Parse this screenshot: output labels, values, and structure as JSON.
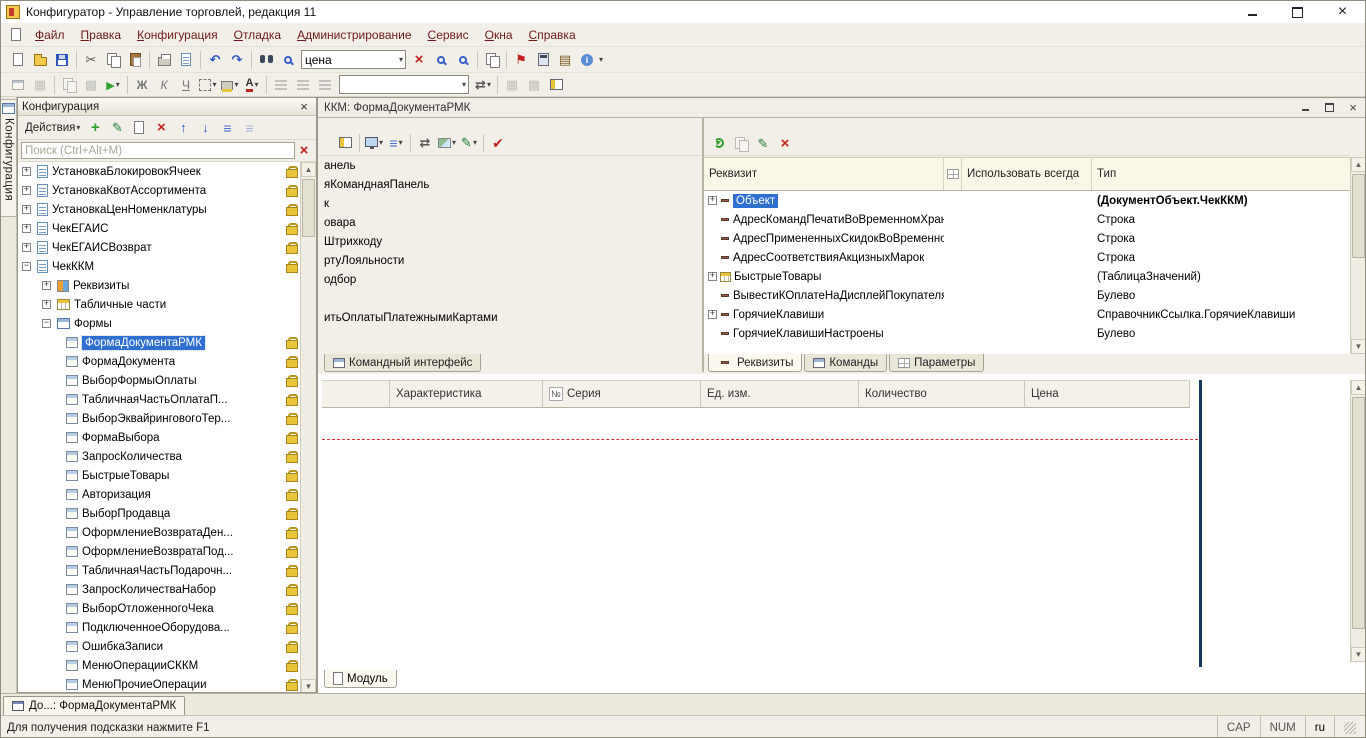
{
  "titlebar": {
    "title": "Конфигуратор - Управление торговлей, редакция 11"
  },
  "menubar": {
    "items": [
      "Файл",
      "Правка",
      "Конфигурация",
      "Отладка",
      "Администрирование",
      "Сервис",
      "Окна",
      "Справка"
    ]
  },
  "toolbar_main": {
    "search_value": "цена"
  },
  "toolbar_format": {
    "bold": "Ж",
    "italic": "К",
    "underline": "Ч"
  },
  "dock": {
    "tab_label": "Конфигурация"
  },
  "config_panel": {
    "title": "Конфигурация",
    "actions_label": "Действия",
    "search_placeholder": "Поиск (Ctrl+Alt+M)",
    "tree": [
      {
        "label": "УстановкаБлокировокЯчеек",
        "locked": true
      },
      {
        "label": "УстановкаКвотАссортимента",
        "locked": true
      },
      {
        "label": "УстановкаЦенНоменклатуры",
        "locked": true
      },
      {
        "label": "ЧекЕГАИС",
        "locked": true
      },
      {
        "label": "ЧекЕГАИСВозврат",
        "locked": true
      },
      {
        "label": "ЧекККМ",
        "locked": true,
        "expanded": true
      },
      {
        "label": "Реквизиты"
      },
      {
        "label": "Табличные части"
      },
      {
        "label": "Формы",
        "expanded": true
      },
      {
        "label": "ФормаДокументаРМК",
        "locked": true,
        "selected": true
      },
      {
        "label": "ФормаДокумента",
        "locked": true
      },
      {
        "label": "ВыборФормыОплаты",
        "locked": true
      },
      {
        "label": "ТабличнаяЧастьОплатаП...",
        "locked": true
      },
      {
        "label": "ВыборЭквайринговогоТер...",
        "locked": true
      },
      {
        "label": "ФормаВыбора",
        "locked": true
      },
      {
        "label": "ЗапросКоличества",
        "locked": true
      },
      {
        "label": "БыстрыеТовары",
        "locked": true
      },
      {
        "label": "Авторизация",
        "locked": true
      },
      {
        "label": "ВыборПродавца",
        "locked": true
      },
      {
        "label": "ОформлениеВозвратаДен...",
        "locked": true
      },
      {
        "label": "ОформлениеВозвратаПод...",
        "locked": true
      },
      {
        "label": "ТабличнаяЧастьПодарочн...",
        "locked": true
      },
      {
        "label": "ЗапросКоличестваНабор",
        "locked": true
      },
      {
        "label": "ВыборОтложенногоЧека",
        "locked": true
      },
      {
        "label": "ПодключенноеОборудова...",
        "locked": true
      },
      {
        "label": "ОшибкаЗаписи",
        "locked": true
      },
      {
        "label": "МенюОперацииСККМ",
        "locked": true
      },
      {
        "label": "МенюПрочиеОперации",
        "locked": true
      }
    ]
  },
  "designer": {
    "title": "ККМ: ФормаДокументаРМК",
    "form_tree": [
      "анель",
      "яКоманднаяПанель",
      "к",
      "овара",
      "Штрихкоду",
      "ртуЛояльности",
      "одбор",
      "итьОплатыПлатежнымиКартами"
    ],
    "left_tab": "Командный интерфейс",
    "attrs": {
      "col_attribute": "Реквизит",
      "col_use_always": "Использовать всегда",
      "col_type": "Тип",
      "rows": [
        {
          "name": "Объект",
          "type": "(ДокументОбъект.ЧекККМ)",
          "selected": true
        },
        {
          "name": "АдресКомандПечатиВоВременномХрани...",
          "type": "Строка"
        },
        {
          "name": "АдресПримененныхСкидокВоВременно...",
          "type": "Строка"
        },
        {
          "name": "АдресСоответствияАкцизныхМарок",
          "type": "Строка"
        },
        {
          "name": "БыстрыеТовары",
          "type": "(ТаблицаЗначений)"
        },
        {
          "name": "ВывестиКОплатеНаДисплейПокупателя",
          "type": "Булево"
        },
        {
          "name": "ГорячиеКлавиши",
          "type": "СправочникСсылка.ГорячиеКлавиши"
        },
        {
          "name": "ГорячиеКлавишиНастроены",
          "type": "Булево"
        }
      ],
      "tabs": [
        "Реквизиты",
        "Команды",
        "Параметры"
      ]
    },
    "preview": {
      "num_badge": "№",
      "columns": [
        "Характеристика",
        "Серия",
        "Ед. изм.",
        "Количество",
        "Цена"
      ]
    },
    "module_tab": "Модуль"
  },
  "bottom_bar": {
    "doc_tab": "До...: ФормаДокументаРМК"
  },
  "statusbar": {
    "hint": "Для получения подсказки нажмите F1",
    "cap": "CAP",
    "num": "NUM",
    "lang": "ru"
  }
}
